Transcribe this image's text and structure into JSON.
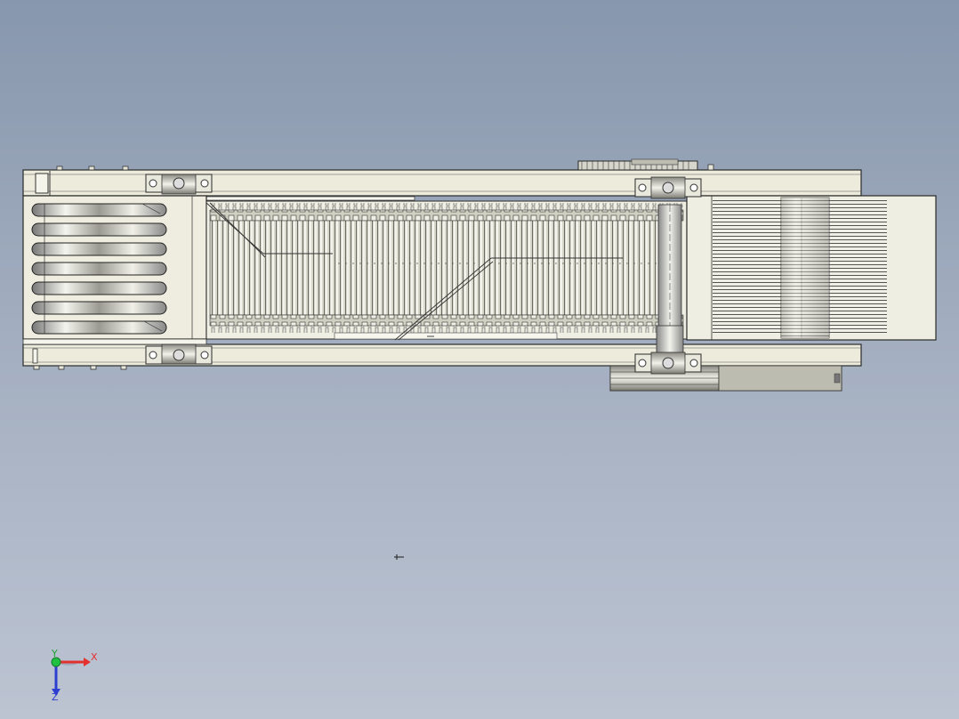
{
  "viewport": {
    "background_top": "#8797ad",
    "background_bottom": "#bcc4d2"
  },
  "model": {
    "name": "chain-plate-conveyor",
    "frame_color": "#ecebdc",
    "edge_color": "#2a2a2a",
    "chain_color": "#b9b8aa",
    "motor_color": "#c9c8bc"
  },
  "triad": {
    "x_label": "X",
    "y_label": "Y",
    "z_label": "Z",
    "x_color": "#e53030",
    "y_color": "#20c040",
    "z_color": "#2d3fd0"
  }
}
